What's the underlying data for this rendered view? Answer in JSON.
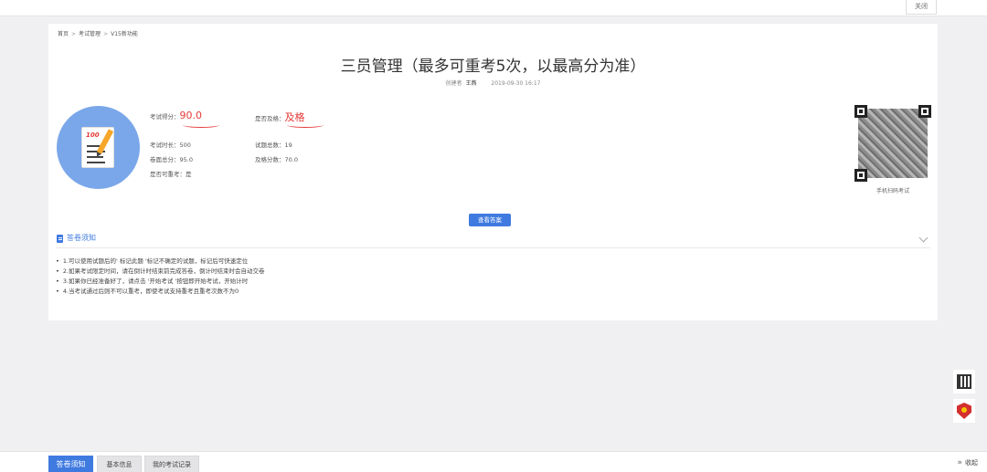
{
  "topbar": {
    "close_label": "关闭"
  },
  "breadcrumb": {
    "items": [
      "首页",
      "考试管理",
      "V15新功能"
    ],
    "separator": ">"
  },
  "exam": {
    "title": "三员管理（最多可重考5次，以最高分为准）",
    "creator_label": "创建者",
    "creator": "王燕",
    "created_at": "2019-09-30 16:17"
  },
  "stats": {
    "score_label": "考试得分：",
    "score_value": "90.0",
    "passed_label": "是否及格：",
    "passed_value": "及格",
    "duration": "考试时长：500",
    "question_count": "试题总数：19",
    "total_score": "卷面总分：95.0",
    "pass_score": "及格分数：70.0",
    "retake": "是否可重考：是"
  },
  "qr": {
    "caption": "手机扫码考试"
  },
  "actions": {
    "view_answers": "查看答案"
  },
  "notice": {
    "title": "答卷须知",
    "rules": [
      "1.可以使用试题后的' 标记此题 '标记不确定的试题，标记后可快速定位",
      "2.如果考试限定时间，请在倒计时结束前完成答卷，倒计时结束时会自动交卷",
      "3.如果你已经准备好了，请点击 '开始考试 '按钮即开始考试，开始计时",
      "4.当考试通过后则不可以重考，即使考试支持重考且重考次数不为0"
    ]
  },
  "bottom_tabs": [
    {
      "label": "答卷须知",
      "active": true
    },
    {
      "label": "基本信息",
      "active": false
    },
    {
      "label": "我的考试记录",
      "active": false
    }
  ],
  "collapse_label": "收起",
  "colors": {
    "accent": "#3f7ae0",
    "highlight": "#e53935",
    "avatar_bg": "#7aa7e9"
  }
}
